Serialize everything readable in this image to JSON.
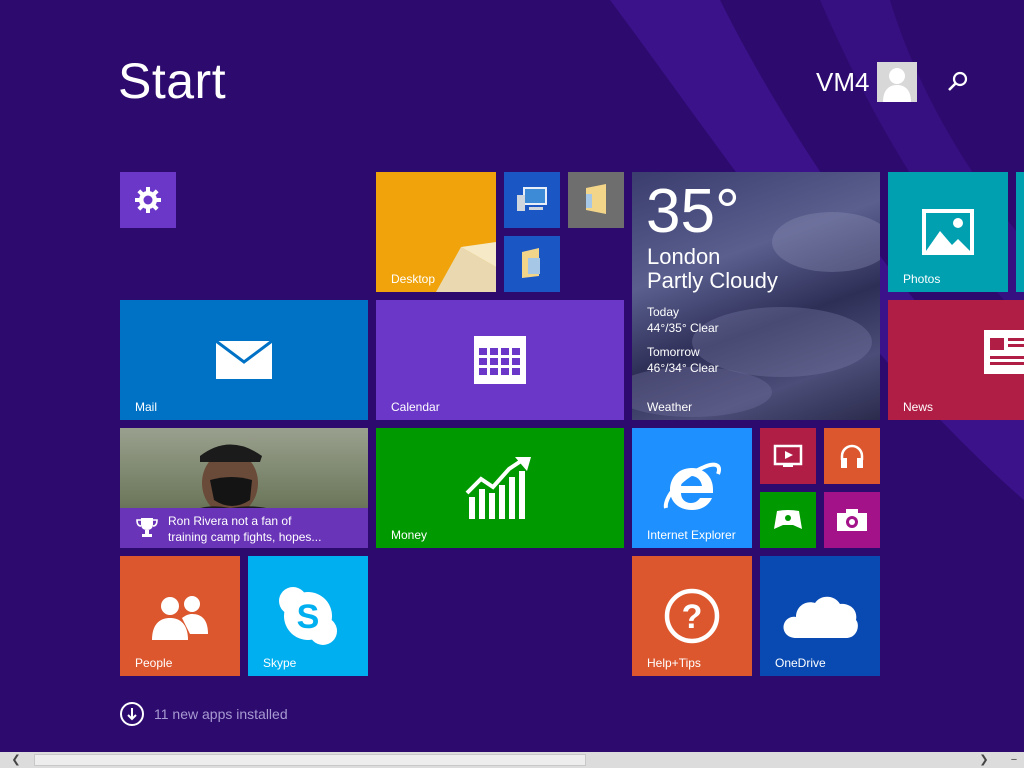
{
  "header": {
    "title": "Start",
    "user_name": "VM4"
  },
  "tiles": {
    "desktop": {
      "label": "Desktop",
      "color": "#f0a30a"
    },
    "mail": {
      "label": "Mail",
      "color": "#0072c6"
    },
    "calendar": {
      "label": "Calendar",
      "color": "#6b37c8"
    },
    "weather": {
      "label": "Weather",
      "temperature": "35°",
      "city": "London",
      "condition": "Partly Cloudy",
      "today_label": "Today",
      "today_forecast": "44°/35° Clear",
      "tomorrow_label": "Tomorrow",
      "tomorrow_forecast": "46°/34° Clear"
    },
    "photos": {
      "label": "Photos",
      "color": "#00a0b1"
    },
    "news": {
      "label": "News",
      "color": "#b01e45"
    },
    "sports": {
      "line1": "Ron Rivera not a fan of",
      "line2": "training camp fights, hopes..."
    },
    "money": {
      "label": "Money",
      "color": "#009a00"
    },
    "internet_explorer": {
      "label": "Internet Explorer",
      "color": "#1e90ff"
    },
    "people": {
      "label": "People",
      "color": "#dc572e"
    },
    "skype": {
      "label": "Skype",
      "color": "#00aff0"
    },
    "help_tips": {
      "label": "Help+Tips",
      "color": "#dc572e"
    },
    "onedrive": {
      "label": "OneDrive",
      "color": "#094ab2"
    }
  },
  "footer": {
    "apps_installed": "11 new apps installed"
  },
  "icons": [
    "settings-icon",
    "computer-icon",
    "file-explorer-icon",
    "folder-icon",
    "video-icon",
    "music-icon",
    "games-icon",
    "camera-icon",
    "search-icon",
    "user-avatar-icon",
    "download-arrow-icon"
  ]
}
